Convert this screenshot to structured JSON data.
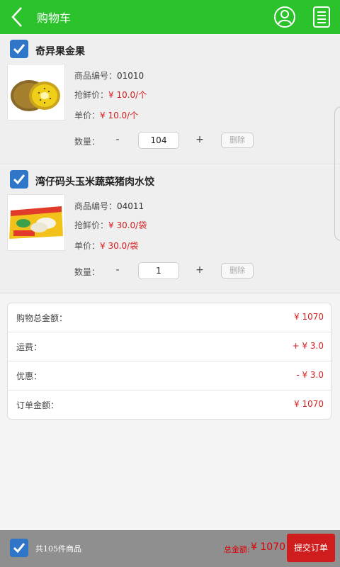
{
  "header": {
    "title": "购物车",
    "back_icon": "back-chevron-icon",
    "user_icon": "user-icon",
    "menu_icon": "list-icon",
    "color": "#2bc22b"
  },
  "items": [
    {
      "name": "奇异果金果",
      "checked": true,
      "thumb_icon": "kiwi-image",
      "code_label": "商品编号：",
      "code": "01010",
      "sale_label": "抢鲜价：",
      "sale_price": "¥ 10.0/个",
      "unit_label": "单价：",
      "unit_price": "¥ 10.0/个",
      "qty_label": "数量：",
      "minus": "-",
      "qty": "104",
      "plus": "+",
      "delete": "删除"
    },
    {
      "name": "湾仔码头玉米蔬菜猪肉水饺",
      "checked": true,
      "thumb_icon": "dumpling-package-image",
      "code_label": "商品编号：",
      "code": "04011",
      "sale_label": "抢鲜价：",
      "sale_price": "¥ 30.0/袋",
      "unit_label": "单价：",
      "unit_price": "¥ 30.0/袋",
      "qty_label": "数量：",
      "minus": "-",
      "qty": "1",
      "plus": "+",
      "delete": "删除"
    }
  ],
  "summary": {
    "total_label": "购物总金额：",
    "total_value": "¥ 1070",
    "shipping_label": "运费：",
    "shipping_value": "+ ¥ 3.0",
    "discount_label": "优惠：",
    "discount_value": "- ¥ 3.0",
    "order_label": "订单金额：",
    "order_value": "¥ 1070"
  },
  "bottom": {
    "count_text": "共105件商品",
    "total_label": "总金额:",
    "total_value": "¥ 1070",
    "submit": "提交订单",
    "accent": "#cf1d1d"
  }
}
